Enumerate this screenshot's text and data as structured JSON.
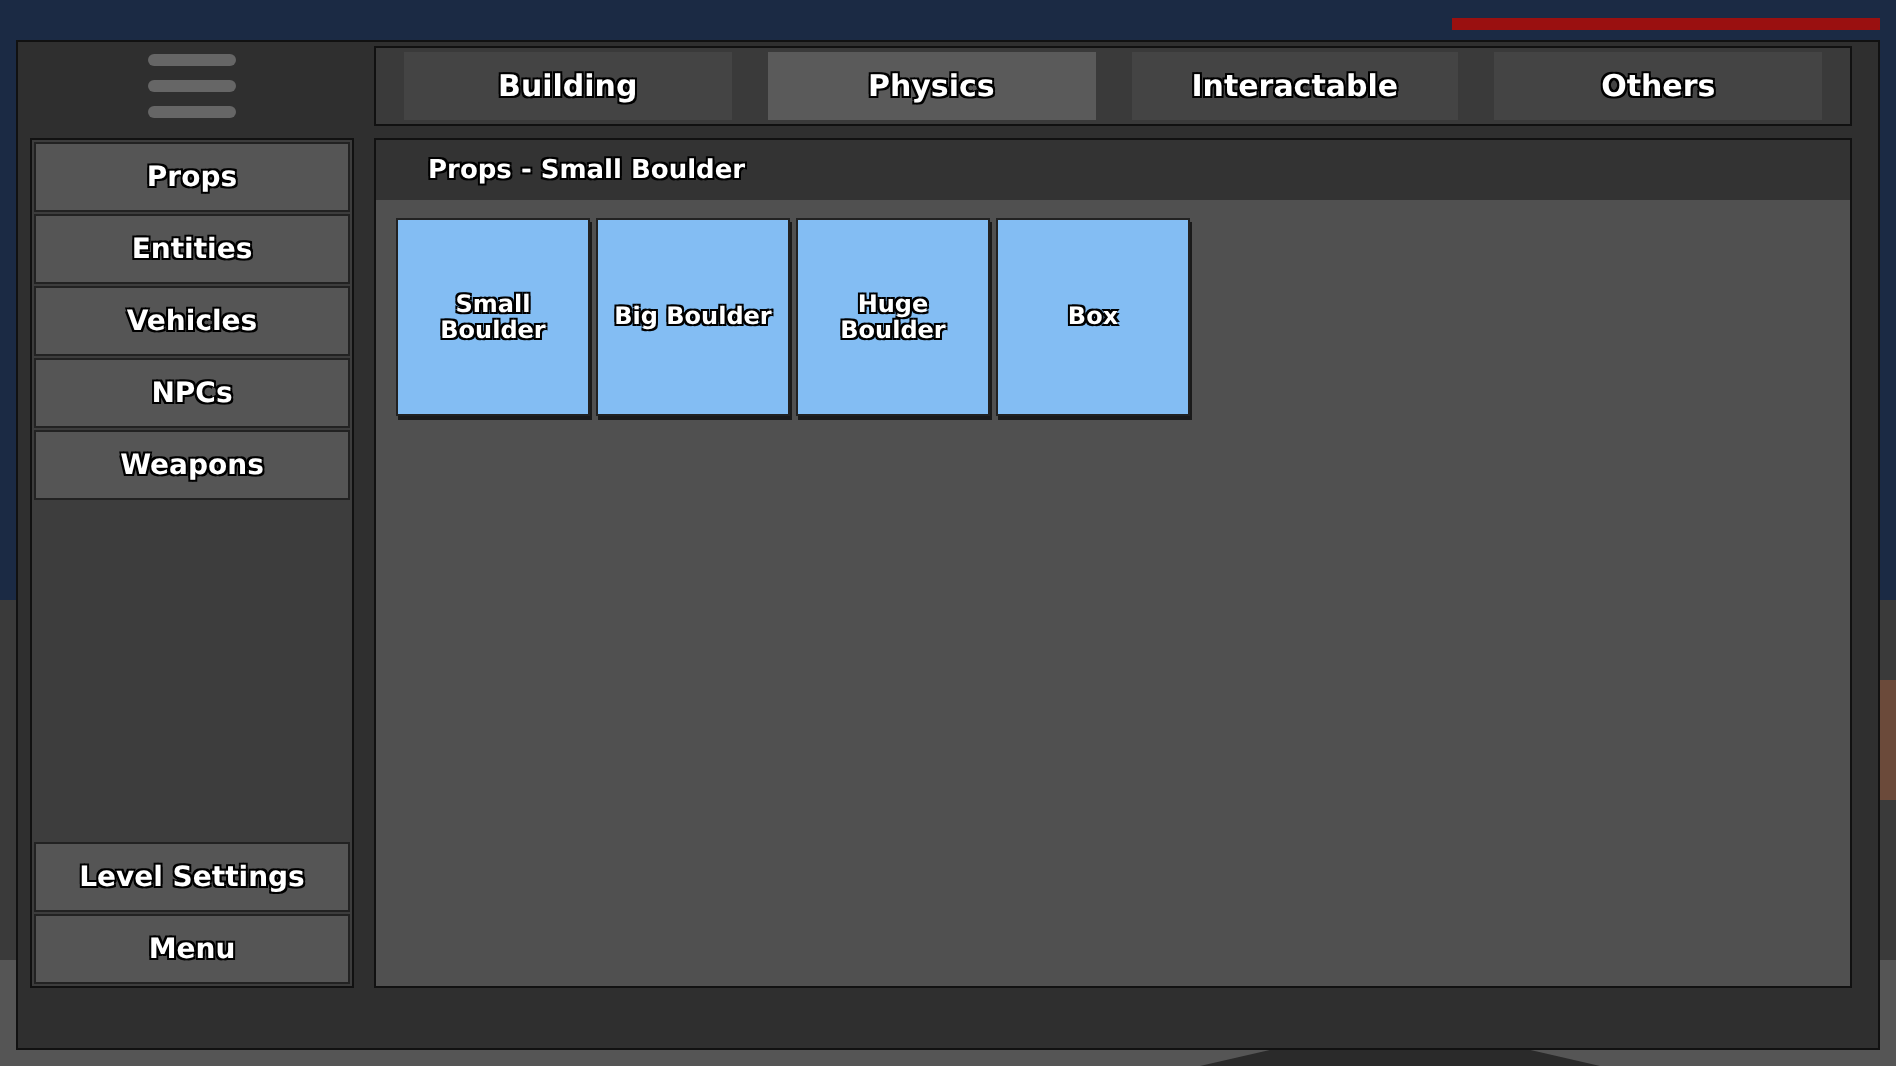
{
  "tabs": [
    {
      "label": "Building",
      "selected": false
    },
    {
      "label": "Physics",
      "selected": true
    },
    {
      "label": "Interactable",
      "selected": false
    },
    {
      "label": "Others",
      "selected": false
    }
  ],
  "sidebar": {
    "items": [
      "Props",
      "Entities",
      "Vehicles",
      "NPCs",
      "Weapons"
    ],
    "bottom_items": [
      "Level Settings",
      "Menu"
    ]
  },
  "content": {
    "header": "Props - Small Boulder",
    "tiles": [
      {
        "label": "Small Boulder"
      },
      {
        "label": "Big Boulder"
      },
      {
        "label": "Huge Boulder"
      },
      {
        "label": "Box"
      }
    ]
  }
}
